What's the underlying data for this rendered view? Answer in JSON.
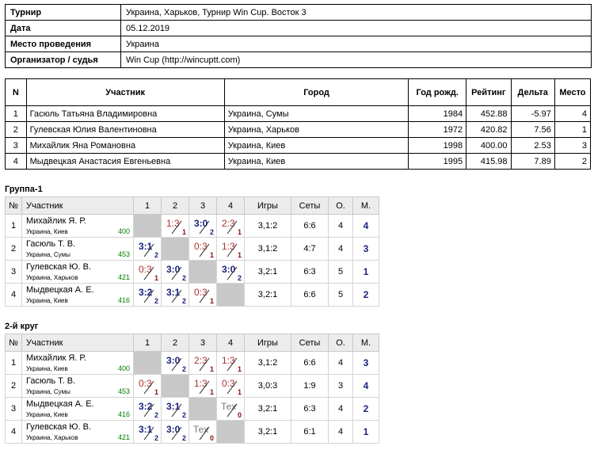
{
  "info": {
    "rows": [
      {
        "key": "Турнир",
        "value": "Украина, Харьков, Турнир Win Cup. Восток 3"
      },
      {
        "key": "Дата",
        "value": "05.12.2019"
      },
      {
        "key": "Место проведения",
        "value": "Украина"
      },
      {
        "key": "Организатор / судья",
        "value": "Win Cup (http://wincuptt.com)"
      }
    ]
  },
  "participants": {
    "headers": [
      "N",
      "Участник",
      "Город",
      "Год рожд.",
      "Рейтинг",
      "Дельта",
      "Место"
    ],
    "rows": [
      {
        "n": "1",
        "name": "Гасюль Татьяна Владимировна",
        "city": "Украина, Сумы",
        "year": "1984",
        "rating": "452.88",
        "delta": "-5.97",
        "place": "4"
      },
      {
        "n": "2",
        "name": "Гулевская Юлия Валентиновна",
        "city": "Украина, Харьков",
        "year": "1972",
        "rating": "420.82",
        "delta": "7.56",
        "place": "1"
      },
      {
        "n": "3",
        "name": "Михайлик Яна Романовна",
        "city": "Украина, Киев",
        "year": "1998",
        "rating": "400.00",
        "delta": "2.53",
        "place": "3"
      },
      {
        "n": "4",
        "name": "Мыдвецкая Анастасия Евгеньевна",
        "city": "Украина, Киев",
        "year": "1995",
        "rating": "415.98",
        "delta": "7.89",
        "place": "2"
      }
    ]
  },
  "groups": [
    {
      "title": "Группа-1",
      "headers": [
        "№",
        "Участник",
        "1",
        "2",
        "3",
        "4",
        "Игры",
        "Сеты",
        "О.",
        "М."
      ],
      "rows": [
        {
          "n": "1",
          "name": "Михайлик Я. Р.",
          "city": "Украина, Киев",
          "rating": "400",
          "cells": [
            null,
            {
              "s": "1:3",
              "p": "1",
              "w": false
            },
            {
              "s": "3:0",
              "p": "2",
              "w": true
            },
            {
              "s": "2:3",
              "p": "1",
              "w": false
            }
          ],
          "games": "3,1:2",
          "sets": "6:6",
          "points": "4",
          "place": "4"
        },
        {
          "n": "2",
          "name": "Гасюль Т. В.",
          "city": "Украина, Сумы",
          "rating": "453",
          "cells": [
            {
              "s": "3:1",
              "p": "2",
              "w": true
            },
            null,
            {
              "s": "0:3",
              "p": "1",
              "w": false
            },
            {
              "s": "1:3",
              "p": "1",
              "w": false
            }
          ],
          "games": "3,1:2",
          "sets": "4:7",
          "points": "4",
          "place": "3"
        },
        {
          "n": "3",
          "name": "Гулевская Ю. В.",
          "city": "Украина, Харьков",
          "rating": "421",
          "cells": [
            {
              "s": "0:3",
              "p": "1",
              "w": false
            },
            {
              "s": "3:0",
              "p": "2",
              "w": true
            },
            null,
            {
              "s": "3:0",
              "p": "2",
              "w": true
            }
          ],
          "games": "3,2:1",
          "sets": "6:3",
          "points": "5",
          "place": "1"
        },
        {
          "n": "4",
          "name": "Мыдвецкая А. Е.",
          "city": "Украина, Киев",
          "rating": "416",
          "cells": [
            {
              "s": "3:2",
              "p": "2",
              "w": true
            },
            {
              "s": "3:1",
              "p": "2",
              "w": true
            },
            {
              "s": "0:3",
              "p": "1",
              "w": false
            },
            null
          ],
          "games": "3,2:1",
          "sets": "6:6",
          "points": "5",
          "place": "2"
        }
      ]
    },
    {
      "title": "2-й круг",
      "headers": [
        "№",
        "Участник",
        "1",
        "2",
        "3",
        "4",
        "Игры",
        "Сеты",
        "О.",
        "М."
      ],
      "rows": [
        {
          "n": "1",
          "name": "Михайлик Я. Р.",
          "city": "Украина, Киев",
          "rating": "400",
          "cells": [
            null,
            {
              "s": "3:0",
              "p": "2",
              "w": true
            },
            {
              "s": "2:3",
              "p": "1",
              "w": false
            },
            {
              "s": "1:3",
              "p": "1",
              "w": false
            }
          ],
          "games": "3,1:2",
          "sets": "6:6",
          "points": "4",
          "place": "3"
        },
        {
          "n": "2",
          "name": "Гасюль Т. В.",
          "city": "Украина, Сумы",
          "rating": "453",
          "cells": [
            {
              "s": "0:3",
              "p": "1",
              "w": false
            },
            null,
            {
              "s": "1:3",
              "p": "1",
              "w": false
            },
            {
              "s": "0:3",
              "p": "1",
              "w": false
            }
          ],
          "games": "3,0:3",
          "sets": "1:9",
          "points": "3",
          "place": "4"
        },
        {
          "n": "3",
          "name": "Мыдвецкая А. Е.",
          "city": "Украина, Киев",
          "rating": "416",
          "cells": [
            {
              "s": "3:2",
              "p": "2",
              "w": true
            },
            {
              "s": "3:1",
              "p": "2",
              "w": true
            },
            null,
            {
              "s": "Тех",
              "p": "0",
              "w": false,
              "tech": true
            }
          ],
          "games": "3,2:1",
          "sets": "6:3",
          "points": "4",
          "place": "2"
        },
        {
          "n": "4",
          "name": "Гулевская Ю. В.",
          "city": "Украина, Харьков",
          "rating": "421",
          "cells": [
            {
              "s": "3:1",
              "p": "2",
              "w": true
            },
            {
              "s": "3:0",
              "p": "2",
              "w": true
            },
            {
              "s": "Тех",
              "p": "0",
              "w": false,
              "tech": true
            },
            null
          ],
          "games": "3,2:1",
          "sets": "6:1",
          "points": "4",
          "place": "1"
        }
      ]
    }
  ]
}
